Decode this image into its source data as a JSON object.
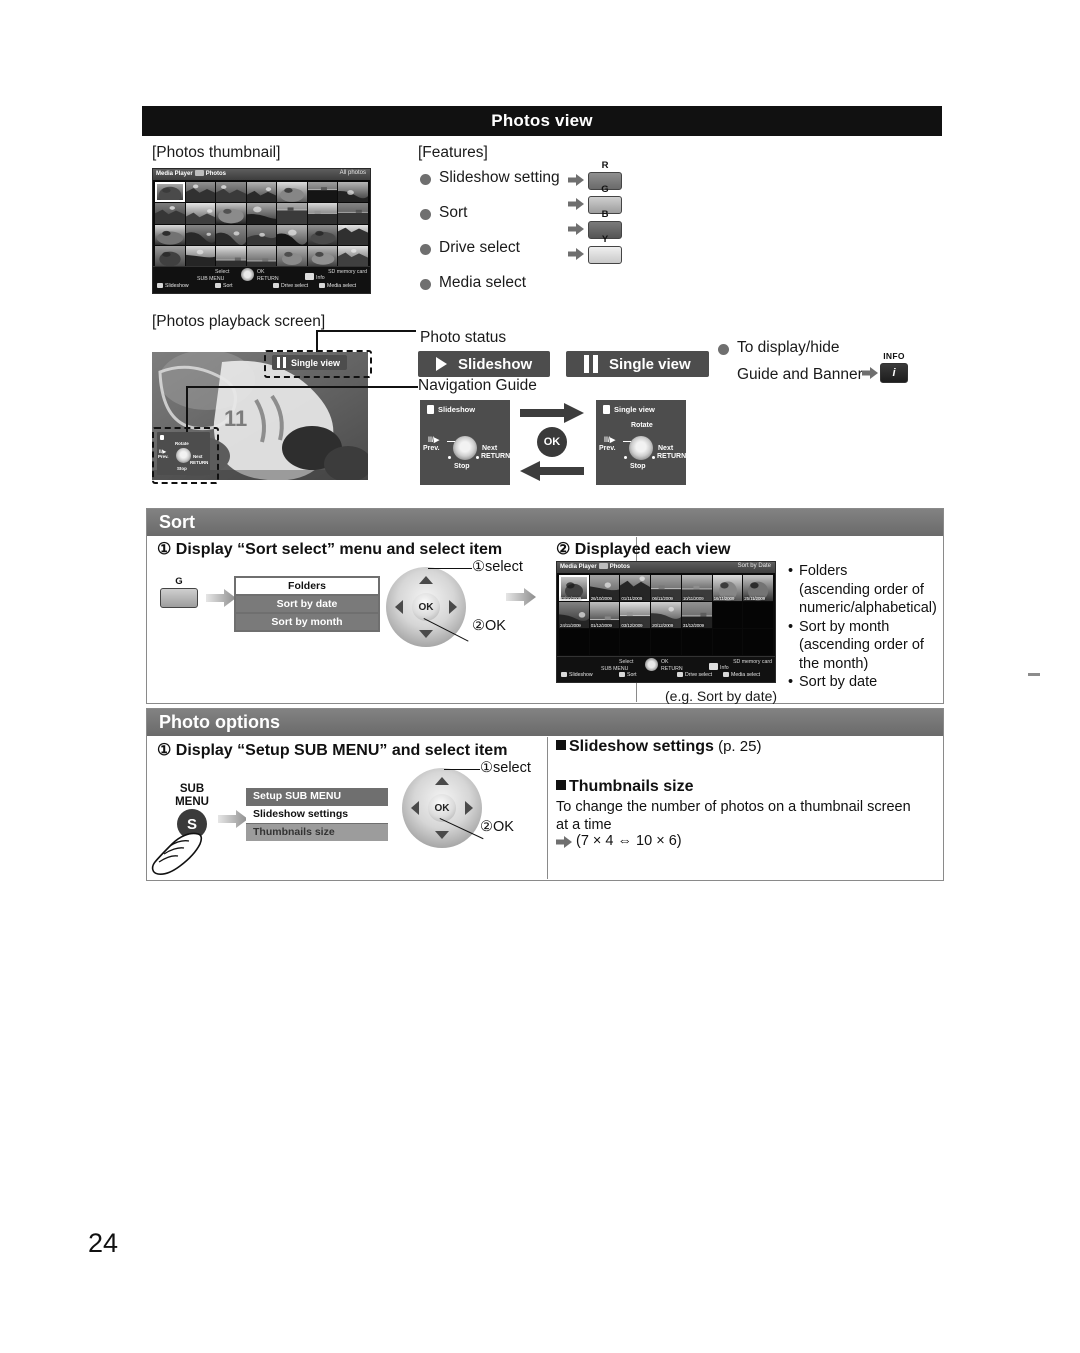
{
  "page": {
    "number": "24",
    "title": "Photos view"
  },
  "photos_view": {
    "thumbnail_caption": "[Photos thumbnail]",
    "features_caption": "[Features]",
    "features": [
      {
        "label": "Slideshow setting",
        "key": "R"
      },
      {
        "label": "Sort",
        "key": "G"
      },
      {
        "label": "Drive select",
        "key": "B"
      },
      {
        "label": "Media select",
        "key": "Y"
      }
    ],
    "thumbnail_screen": {
      "header_left": "Media Player",
      "header_sub": "Photos",
      "header_right": "All photos",
      "footer_select": "Select",
      "footer_ok": "OK",
      "footer_submenu": "SUB MENU",
      "footer_return": "RETURN",
      "footer_info": "Info",
      "footer_media": "SD memory card",
      "color_buttons": [
        "Slideshow",
        "Sort",
        "Drive select",
        "Media select"
      ]
    }
  },
  "playback": {
    "caption": "[Photos playback screen]",
    "photo_status_label": "Photo status",
    "navigation_guide_label": "Navigation Guide",
    "status_chip": "Single view",
    "badges": [
      {
        "icon": "play-icon",
        "label": "Slideshow"
      },
      {
        "icon": "pause-icon",
        "label": "Single view"
      }
    ],
    "nav_panels": [
      {
        "title": "Slideshow",
        "up": "",
        "left_top": "ll/▶",
        "left_bottom": "Prev.",
        "right": "Next",
        "return": "RETURN",
        "down": "Stop"
      },
      {
        "title": "Single view",
        "up": "Rotate",
        "left_top": "ll/▶",
        "left_bottom": "Prev.",
        "right": "Next",
        "return": "RETURN",
        "down": "Stop"
      }
    ],
    "ok_label": "OK",
    "display_hide": {
      "line1": "To display/hide",
      "line2": "Guide and Banner",
      "key": "INFO",
      "key_glyph": "i"
    },
    "mini_guide": {
      "up": "Rotate",
      "left_top": "ll/▶",
      "left_bottom": "Prev.",
      "right": "Next",
      "return": "RETURN",
      "down": "Stop"
    }
  },
  "sort": {
    "heading": "Sort",
    "step1": "① Display “Sort select” menu and select item",
    "step2": "② Displayed each view",
    "key": "G",
    "menu": [
      {
        "label": "Folders",
        "selected": true
      },
      {
        "label": "Sort by date",
        "selected": false
      },
      {
        "label": "Sort by month",
        "selected": false
      }
    ],
    "dpad": {
      "select": "①select",
      "ok": "②OK",
      "ok_label": "OK"
    },
    "example_caption": "(e.g. Sort by date)",
    "notes": [
      "Folders",
      "(ascending order of",
      "numeric/alphabetical)",
      "Sort by month",
      "(ascending order of",
      "the month)",
      "Sort by date"
    ],
    "sorted_screen": {
      "header_left": "Media Player",
      "header_sub": "Photos",
      "header_right": "Sort by Date",
      "dates_row1": [
        "23/10/2009",
        "26/10/2009",
        "01/11/2009",
        "06/11/2009",
        "10/11/2009",
        "16/11/2009",
        "25/11/2009"
      ],
      "dates_row2": [
        "24/11/2009",
        "01/12/2009",
        "03/12/2009",
        "20/12/2009",
        "31/12/2009"
      ],
      "footer_select": "Select",
      "footer_ok": "OK",
      "footer_submenu": "SUB MENU",
      "footer_return": "RETURN",
      "footer_info": "Info",
      "footer_media": "SD memory card",
      "color_buttons": [
        "Slideshow",
        "Sort",
        "Drive select",
        "Media select"
      ]
    }
  },
  "photo_options": {
    "heading": "Photo options",
    "step1": "① Display “Setup SUB MENU” and select item",
    "sub_button_line1": "SUB",
    "sub_button_line2": "MENU",
    "sub_button_glyph": "S",
    "menu_header": "Setup SUB MENU",
    "menu": [
      {
        "label": "Slideshow settings",
        "selected": true
      },
      {
        "label": "Thumbnails size",
        "selected": false
      }
    ],
    "dpad": {
      "select": "①select",
      "ok": "②OK",
      "ok_label": "OK"
    },
    "right": {
      "slideshow_settings": "Slideshow settings",
      "slideshow_settings_ref": " (p. 25)",
      "thumbnails_size": "Thumbnails size",
      "thumbnails_desc_line1": "To change the number of photos on a thumbnail screen",
      "thumbnails_desc_line2": "at a time",
      "thumbnails_values": "(7 × 4 ⇔ 10 × 6)"
    }
  }
}
